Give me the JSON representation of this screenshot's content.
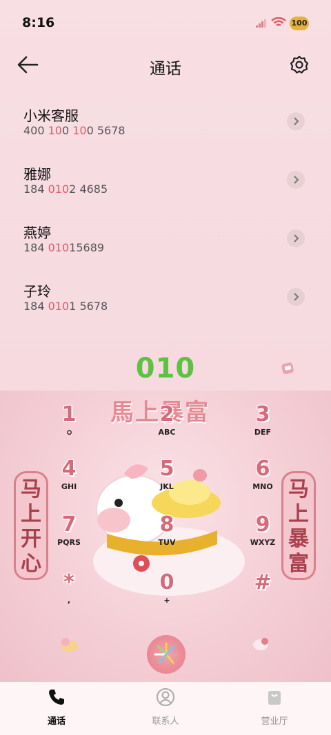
{
  "status": {
    "time": "8:16",
    "battery": "100"
  },
  "header": {
    "title": "通话"
  },
  "contacts": [
    {
      "name": "小米客服",
      "num_pre": "400 ",
      "num_hl1": "10",
      "num_mid": "0 ",
      "num_hl2": "10",
      "num_post": "0 5678"
    },
    {
      "name": "雅娜",
      "num_pre": "184 ",
      "num_hl1": "010",
      "num_mid": "",
      "num_hl2": "",
      "num_post": "2 4685"
    },
    {
      "name": "燕婷",
      "num_pre": "184 ",
      "num_hl1": "010",
      "num_mid": "",
      "num_hl2": "",
      "num_post": "15689"
    },
    {
      "name": "子玲",
      "num_pre": "184 ",
      "num_hl1": "010",
      "num_mid": "",
      "num_hl2": "",
      "num_post": "1 5678"
    }
  ],
  "dialed": "010",
  "decor": {
    "banner": "馬上暴富",
    "left": "马上开心",
    "right": "马上暴富"
  },
  "keys": [
    {
      "digit": "1",
      "letters": "ഠ"
    },
    {
      "digit": "2",
      "letters": "ABC"
    },
    {
      "digit": "3",
      "letters": "DEF"
    },
    {
      "digit": "4",
      "letters": "GHI"
    },
    {
      "digit": "5",
      "letters": "JKL"
    },
    {
      "digit": "6",
      "letters": "MNO"
    },
    {
      "digit": "7",
      "letters": "PQRS"
    },
    {
      "digit": "8",
      "letters": "TUV"
    },
    {
      "digit": "9",
      "letters": "WXYZ"
    },
    {
      "digit": "*",
      "letters": ","
    },
    {
      "digit": "0",
      "letters": "+"
    },
    {
      "digit": "#",
      "letters": ""
    }
  ],
  "tabs": [
    {
      "label": "通话",
      "icon": "phone-icon"
    },
    {
      "label": "联系人",
      "icon": "person-icon"
    },
    {
      "label": "营业厅",
      "icon": "bag-icon"
    }
  ],
  "colors": {
    "accent_green": "#5cc241",
    "highlight": "#e05a63"
  }
}
